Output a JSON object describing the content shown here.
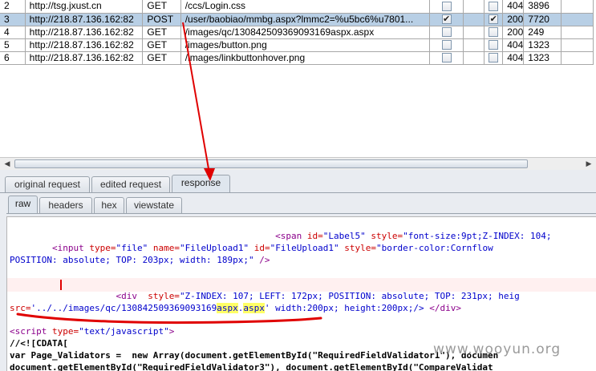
{
  "requests": [
    {
      "num": "2",
      "host": "http://tsg.jxust.cn",
      "method": "GET",
      "url": "/ccs/Login.css",
      "edited": false,
      "intercepted": false,
      "status": "404",
      "length": "3896"
    },
    {
      "num": "3",
      "host": "http://218.87.136.162:82",
      "method": "POST",
      "url": "/user/baobiao/mmbg.aspx?lmmc2=%u5bc6%u7801...",
      "edited": true,
      "intercepted": true,
      "status": "200",
      "length": "7720",
      "selected": true
    },
    {
      "num": "4",
      "host": "http://218.87.136.162:82",
      "method": "GET",
      "url": "/images/qc/130842509369093169aspx.aspx",
      "edited": false,
      "intercepted": false,
      "status": "200",
      "length": "249"
    },
    {
      "num": "5",
      "host": "http://218.87.136.162:82",
      "method": "GET",
      "url": "/images/button.png",
      "edited": false,
      "intercepted": false,
      "status": "404",
      "length": "1323"
    },
    {
      "num": "6",
      "host": "http://218.87.136.162:82",
      "method": "GET",
      "url": "/images/linkbuttonhover.png",
      "edited": false,
      "intercepted": false,
      "status": "404",
      "length": "1323"
    }
  ],
  "tabs": {
    "request_tabs": [
      "original request",
      "edited request",
      "response"
    ],
    "active_request_tab": "response",
    "view_tabs": [
      "raw",
      "headers",
      "hex",
      "viewstate"
    ],
    "active_view_tab": "raw"
  },
  "code": {
    "l1": {
      "indent": "                                                  ",
      "open": "<span",
      "a1": " id=",
      "v1": "\"Label5\"",
      "a2": " style=",
      "v2": "\"font-size:9pt;Z-INDEX: 104;"
    },
    "l2": {
      "indent": "        ",
      "open": "<input",
      "a1": " type=",
      "v1": "\"file\"",
      "a2": " name=",
      "v2": "\"FileUpload1\"",
      "a3": " id=",
      "v3": "\"FileUpload1\"",
      "a4": " style=",
      "v4": "\"border-color:Cornflow"
    },
    "l3": {
      "text": "POSITION: absolute; TOP: 203px; width: 189px;\"",
      "close": " />"
    },
    "l5": {
      "indent": "                    ",
      "open": "<div",
      "a1": "  style=",
      "v1": "\"Z-INDEX: 107; LEFT: 172px; POSITION: absolute; TOP: 231px; heig"
    },
    "l6": {
      "a1": "src=",
      "v1": "'../../images/qc/130842509369093169",
      "h1": "aspx",
      "dot": ".",
      "h2": "aspx",
      "v2": "'",
      "rest": " width:200px; height:200px;/> ",
      "close": "</div>"
    },
    "l8": {
      "open": "<script",
      "a1": " type=",
      "v1": "\"text/javascript\"",
      "close": ">"
    },
    "l9": {
      "text": "//<![CDATA["
    },
    "l10": {
      "text": "var Page_Validators =  new Array(document.getElementById(\"RequiredFieldValidator1\"), documen"
    },
    "l11": {
      "text": "document.getElementById(\"RequiredFieldValidator3\"), document.getElementById(\"CompareValidat"
    }
  },
  "watermark": "www.wooyun.org",
  "colors": {
    "selected_row": "#b8cfe5",
    "annotation": "#e00000",
    "highlight": "#ffff66"
  }
}
